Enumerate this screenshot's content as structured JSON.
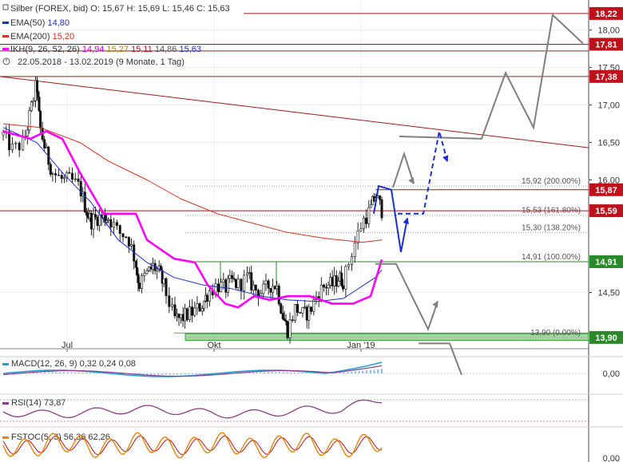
{
  "header": {
    "instrument": "Silber (FOREX, bid)",
    "o_label": "O:",
    "o": "15,67",
    "h_label": "H:",
    "h": "15,69",
    "l_label": "L:",
    "l": "15,46",
    "c_label": "C:",
    "c": "15,63",
    "ema50_label": "EMA(50)",
    "ema50_value": "14,80",
    "ema200_label": "EMA(200)",
    "ema200_value": "15,20",
    "ikh_label": "IKH(9, 26, 52, 26)",
    "ikh_values": [
      "14,94",
      "15,27",
      "15,11",
      "14,86",
      "15,63"
    ],
    "date_range": "22.05.2018 - 13.02.2019",
    "period": "(9 Monate, 1 Tag)"
  },
  "colors": {
    "ema50": "#1a2fd6",
    "ema200": "#d9301e",
    "ikh": "#ff00ff",
    "tag_red": "#c0111b",
    "tag_green": "#2a8a2a",
    "forecast": "#7f7f7f",
    "arrow_blue": "#1a2fd6",
    "zone_green": "#7cc47c",
    "macd": "#27a0d0",
    "macd_signal": "#8b3c8b",
    "rsi": "#8b3c8b",
    "fstoc_fast": "#e8860c",
    "fstoc_slow": "#c0111b"
  },
  "chart_data": {
    "type": "candlestick",
    "y_axis": {
      "ticks": [
        "18,00",
        "17,50",
        "17,00",
        "16,50",
        "16,00",
        "14,50"
      ],
      "ylim": [
        13.75,
        18.4
      ]
    },
    "x_axis": {
      "ticks": [
        "Jul",
        "Okt",
        "Jan '19"
      ]
    },
    "price_tags": [
      {
        "value": "18,22",
        "kind": "resistance"
      },
      {
        "value": "17,81",
        "kind": "resistance"
      },
      {
        "value": "17,38",
        "kind": "resistance"
      },
      {
        "value": "15,87",
        "kind": "resistance"
      },
      {
        "value": "15,59",
        "kind": "current"
      },
      {
        "value": "14,91",
        "kind": "support"
      },
      {
        "value": "13,90",
        "kind": "support"
      }
    ],
    "fibonacci": [
      {
        "label": "15,92 (200.00%)",
        "level": 15.92
      },
      {
        "label": "15,53 (161.80%)",
        "level": 15.53
      },
      {
        "label": "15,30 (138.20%)",
        "level": 15.3
      },
      {
        "label": "14,91 (100.00%)",
        "level": 14.91
      },
      {
        "label": "13,90 (0.00%)",
        "level": 13.9
      }
    ],
    "close_path": [
      [
        "2018-05-22",
        16.6
      ],
      [
        "2018-05-28",
        16.4
      ],
      [
        "2018-06-04",
        16.5
      ],
      [
        "2018-06-08",
        16.9
      ],
      [
        "2018-06-12",
        17.3
      ],
      [
        "2018-06-14",
        16.7
      ],
      [
        "2018-06-18",
        16.35
      ],
      [
        "2018-06-22",
        16.1
      ],
      [
        "2018-06-28",
        16.0
      ],
      [
        "2018-07-03",
        16.0
      ],
      [
        "2018-07-09",
        15.9
      ],
      [
        "2018-07-13",
        15.6
      ],
      [
        "2018-07-16",
        15.45
      ],
      [
        "2018-07-20",
        15.5
      ],
      [
        "2018-07-24",
        15.5
      ],
      [
        "2018-07-27",
        15.5
      ],
      [
        "2018-08-02",
        15.3
      ],
      [
        "2018-08-08",
        15.25
      ],
      [
        "2018-08-13",
        14.9
      ],
      [
        "2018-08-15",
        14.6
      ],
      [
        "2018-08-20",
        14.75
      ],
      [
        "2018-08-24",
        14.85
      ],
      [
        "2018-08-28",
        14.75
      ],
      [
        "2018-08-31",
        14.55
      ],
      [
        "2018-09-06",
        14.15
      ],
      [
        "2018-09-10",
        14.15
      ],
      [
        "2018-09-14",
        14.2
      ],
      [
        "2018-09-19",
        14.25
      ],
      [
        "2018-09-24",
        14.35
      ],
      [
        "2018-09-27",
        14.5
      ],
      [
        "2018-10-03",
        14.6
      ],
      [
        "2018-10-08",
        14.55
      ],
      [
        "2018-10-12",
        14.65
      ],
      [
        "2018-10-16",
        14.6
      ],
      [
        "2018-10-22",
        14.7
      ],
      [
        "2018-10-26",
        14.55
      ],
      [
        "2018-10-31",
        14.5
      ],
      [
        "2018-11-05",
        14.6
      ],
      [
        "2018-11-09",
        14.6
      ],
      [
        "2018-11-13",
        14.2
      ],
      [
        "2018-11-16",
        14.0
      ],
      [
        "2018-11-21",
        14.3
      ],
      [
        "2018-11-26",
        14.2
      ],
      [
        "2018-11-30",
        14.25
      ],
      [
        "2018-12-05",
        14.5
      ],
      [
        "2018-12-10",
        14.6
      ],
      [
        "2018-12-14",
        14.6
      ],
      [
        "2018-12-18",
        14.7
      ],
      [
        "2018-12-21",
        14.65
      ],
      [
        "2018-12-27",
        15.1
      ],
      [
        "2019-01-02",
        15.45
      ],
      [
        "2019-01-07",
        15.6
      ],
      [
        "2019-01-10",
        15.8
      ],
      [
        "2019-01-14",
        15.6
      ]
    ],
    "series": [
      {
        "name": "EMA(50)",
        "values": [
          [
            0,
            16.7
          ],
          [
            4,
            16.5
          ],
          [
            8,
            16.1
          ],
          [
            12,
            15.7
          ],
          [
            16,
            15.2
          ],
          [
            20,
            14.9
          ],
          [
            24,
            14.7
          ],
          [
            28,
            14.6
          ],
          [
            32,
            14.55
          ],
          [
            36,
            14.45
          ],
          [
            40,
            14.4
          ],
          [
            44,
            14.38
          ],
          [
            48,
            14.42
          ],
          [
            52,
            14.7
          ],
          [
            53,
            14.8
          ]
        ]
      },
      {
        "name": "EMA(200)",
        "values": [
          [
            0,
            16.75
          ],
          [
            5,
            16.7
          ],
          [
            10,
            16.5
          ],
          [
            15,
            16.25
          ],
          [
            20,
            16.0
          ],
          [
            25,
            15.75
          ],
          [
            30,
            15.55
          ],
          [
            35,
            15.42
          ],
          [
            40,
            15.3
          ],
          [
            45,
            15.22
          ],
          [
            50,
            15.17
          ],
          [
            53,
            15.2
          ]
        ]
      },
      {
        "name": "IKH(9, 26, 52, 26)",
        "values": [
          [
            0,
            16.65
          ],
          [
            3,
            16.55
          ],
          [
            6,
            16.65
          ],
          [
            8,
            16.55
          ],
          [
            10,
            16.1
          ],
          [
            14,
            15.55
          ],
          [
            18,
            15.55
          ],
          [
            20,
            15.2
          ],
          [
            24,
            14.95
          ],
          [
            27,
            14.9
          ],
          [
            29,
            14.6
          ],
          [
            31,
            14.35
          ],
          [
            33,
            14.3
          ],
          [
            35,
            14.45
          ],
          [
            37,
            14.4
          ],
          [
            40,
            14.45
          ],
          [
            43,
            14.45
          ],
          [
            46,
            14.35
          ],
          [
            49,
            14.35
          ],
          [
            51,
            14.45
          ],
          [
            53,
            14.94
          ]
        ]
      }
    ],
    "indicators": [
      {
        "name": "MACD(12, 26, 9)",
        "values_text": [
          "0,32",
          "0,24",
          "0,08"
        ],
        "axis_tick": "0,00"
      },
      {
        "name": "RSI(14)",
        "values_text": [
          "73,87"
        ]
      },
      {
        "name": "FSTOC(5, 3)",
        "values_text": [
          "56,36",
          "62,26"
        ],
        "axis_tick": "0,00"
      }
    ]
  }
}
